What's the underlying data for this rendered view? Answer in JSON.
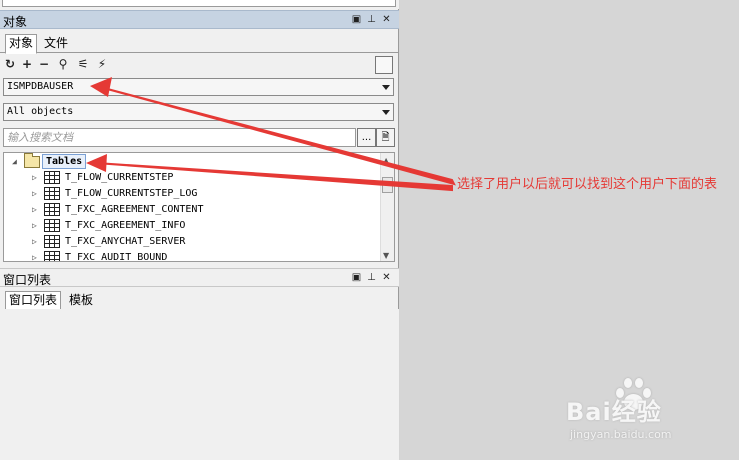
{
  "objects_panel": {
    "title": "对象",
    "tabs": [
      "对象",
      "文件"
    ],
    "user_combo": "ISMPDBAUSER",
    "objects_combo": "All objects",
    "search_placeholder": "输入搜索文档",
    "search_btn_label": "...",
    "tree": {
      "root_label": "Tables",
      "items": [
        "T_FLOW_CURRENTSTEP",
        "T_FLOW_CURRENTSTEP_LOG",
        "T_FXC_AGREEMENT_CONTENT",
        "T_FXC_AGREEMENT_INFO",
        "T_FXC_ANYCHAT_SERVER",
        "T_FXC_AUDIT_BOUND"
      ]
    }
  },
  "window_list_panel": {
    "title": "窗口列表",
    "tabs": [
      "窗口列表",
      "模板"
    ]
  },
  "annotation": {
    "text": "选择了用户以后就可以找到这个用户下面的表",
    "color": "#e53935"
  },
  "watermark": {
    "brand": "Bai经验",
    "url": "jingyan.baidu.com"
  },
  "icons": {
    "toolbar": [
      "refresh-icon",
      "add-icon",
      "remove-icon",
      "find-icon",
      "filter-icon",
      "filter-clear-icon"
    ],
    "header": [
      "float-icon",
      "pin-icon",
      "close-icon"
    ]
  }
}
